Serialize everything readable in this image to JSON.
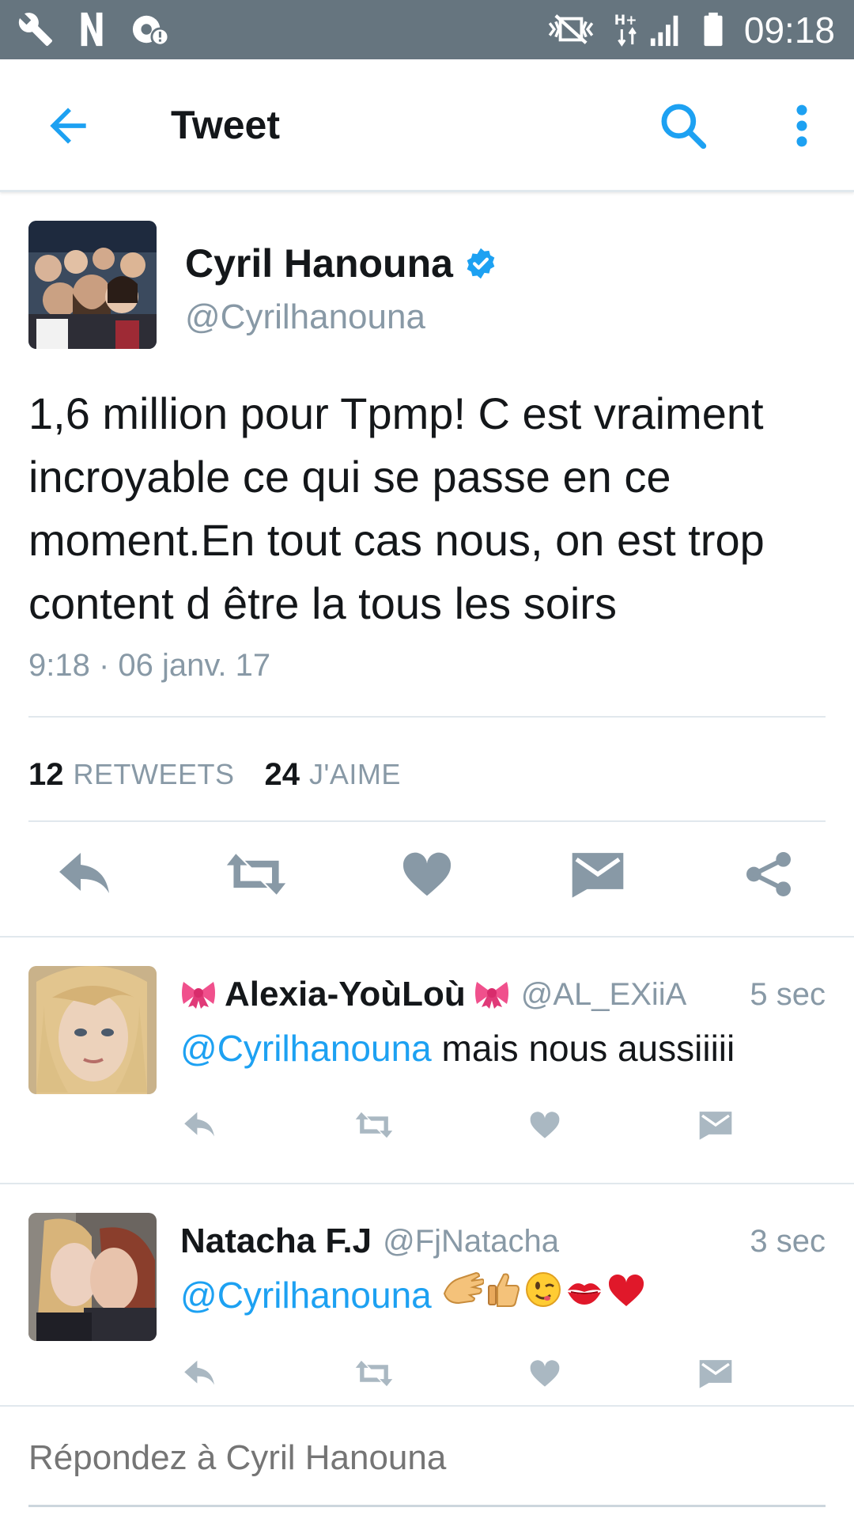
{
  "status_bar": {
    "time": "09:18",
    "network_label": "H+",
    "icons": [
      "wrench-icon",
      "netflix-n-icon",
      "settings-alert-icon",
      "vibrate-mute-icon",
      "network-hplus-icon",
      "signal-icon",
      "battery-icon"
    ]
  },
  "header": {
    "title": "Tweet",
    "icons": [
      "back-arrow-icon",
      "search-icon",
      "more-vert-icon"
    ]
  },
  "colors": {
    "accent": "#1da1f2",
    "secondary_text": "#8899a6",
    "action_gray": "#8899a6",
    "status_bar": "#66757f",
    "divider": "#e1e8ed"
  },
  "tweet": {
    "author_name": "Cyril Hanouna",
    "verified": true,
    "handle": "@Cyrilhanouna",
    "text": "1,6 million pour Tpmp! C est vraiment incroyable ce qui se passe en ce moment.En tout cas nous, on est trop content d être la tous les soirs",
    "timestamp": "9:18 · 06 janv. 17",
    "retweets_count": "12",
    "retweets_label": "RETWEETS",
    "likes_count": "24",
    "likes_label": "J'AIME",
    "actions": [
      "reply-icon",
      "retweet-icon",
      "like-icon",
      "message-icon",
      "share-icon"
    ]
  },
  "replies": [
    {
      "name": "Alexia-YoùLoù",
      "handle": "@AL_EXiiA",
      "time": "5 sec",
      "mention": "@Cyrilhanouna",
      "text": " mais nous aussiiiii",
      "name_emojis": [
        "ribbon-emoji",
        "ribbon-emoji"
      ]
    },
    {
      "name": "Natacha F.J",
      "handle": "@FjNatacha",
      "time": "3 sec",
      "mention": "@Cyrilhanouna",
      "text": "",
      "emojis": [
        "clapping-hands-emoji",
        "thumbs-up-emoji",
        "winking-face-emoji",
        "kiss-mark-emoji",
        "red-heart-emoji"
      ]
    }
  ],
  "composer": {
    "placeholder": "Répondez à Cyril Hanouna"
  }
}
